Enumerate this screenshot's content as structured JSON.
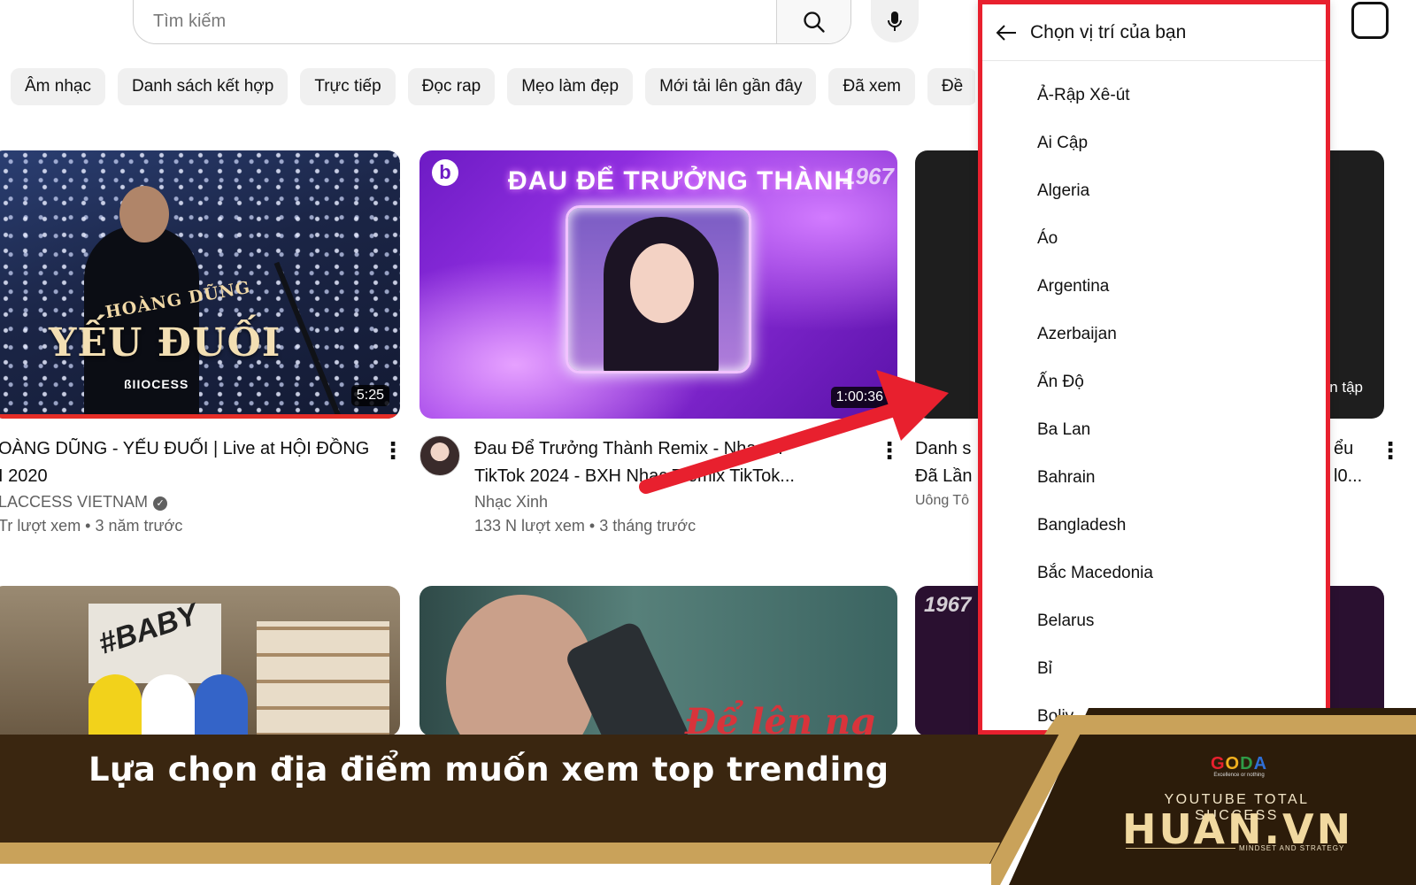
{
  "search": {
    "placeholder": "Tìm kiếm"
  },
  "chips": [
    "Âm nhạc",
    "Danh sách kết hợp",
    "Trực tiếp",
    "Đọc rap",
    "Mẹo làm đẹp",
    "Mới tải lên gần đây",
    "Đã xem",
    "Đề"
  ],
  "videos": [
    {
      "thumb_artist": "HOÀNG DŨNG",
      "thumb_title": "YẾU ĐUỐI",
      "thumb_brand": "ßIIOCESS",
      "duration": "5:25",
      "title_line1": "OÀNG DŨNG - YẾU ĐUỐI | Live at HỘI ĐỒNG",
      "title_line2": "I 2020",
      "channel": "LACCESS VIETNAM",
      "meta": "Tr lượt xem • 3 năm trước"
    },
    {
      "thumb_title": "ĐAU ĐỂ TRƯỞNG THÀNH",
      "thumb_logo": "1967",
      "duration": "1:00:36",
      "title_line1": "Đau Để Trưởng Thành Remix - Nhạc H",
      "title_line2": "TikTok 2024 - BXH Nhạc T      emix TikTok...",
      "channel": "Nhạc Xinh",
      "meta": "133 N lượt xem • 3 tháng trước"
    },
    {
      "side_text": "yển tập",
      "title_line1": "Danh s",
      "title_line2": "Đã Lần",
      "channel": "Uông Tô",
      "right_line1": "ểu",
      "right_line2": "l0..."
    },
    {
      "graffiti": "#BABY"
    },
    {
      "script": "Để lên ng"
    },
    {
      "thumb_logo": "1967"
    }
  ],
  "location_dialog": {
    "title": "Chọn vị trí của bạn",
    "countries": [
      "Ả-Rập Xê-út",
      "Ai Cập",
      "Algeria",
      "Áo",
      "Argentina",
      "Azerbaijan",
      "Ấn Độ",
      "Ba Lan",
      "Bahrain",
      "Bangladesh",
      "Bắc Macedonia",
      "Belarus",
      "Bỉ",
      "Boliv"
    ]
  },
  "banner": {
    "caption": "Lựa chọn địa điểm muốn xem top trending",
    "logo_word": "GODA",
    "logo_tagline": "Excellence or nothing",
    "brand_subtitle": "YOUTUBE TOTAL SUCCESS",
    "brand_name": "HUAN.VN",
    "brand_tagline": "MINDSET AND STRATEGY"
  },
  "colors": {
    "highlight_red": "#e8202e",
    "banner_dark": "#3a2610",
    "banner_gold": "#c9a25a"
  }
}
